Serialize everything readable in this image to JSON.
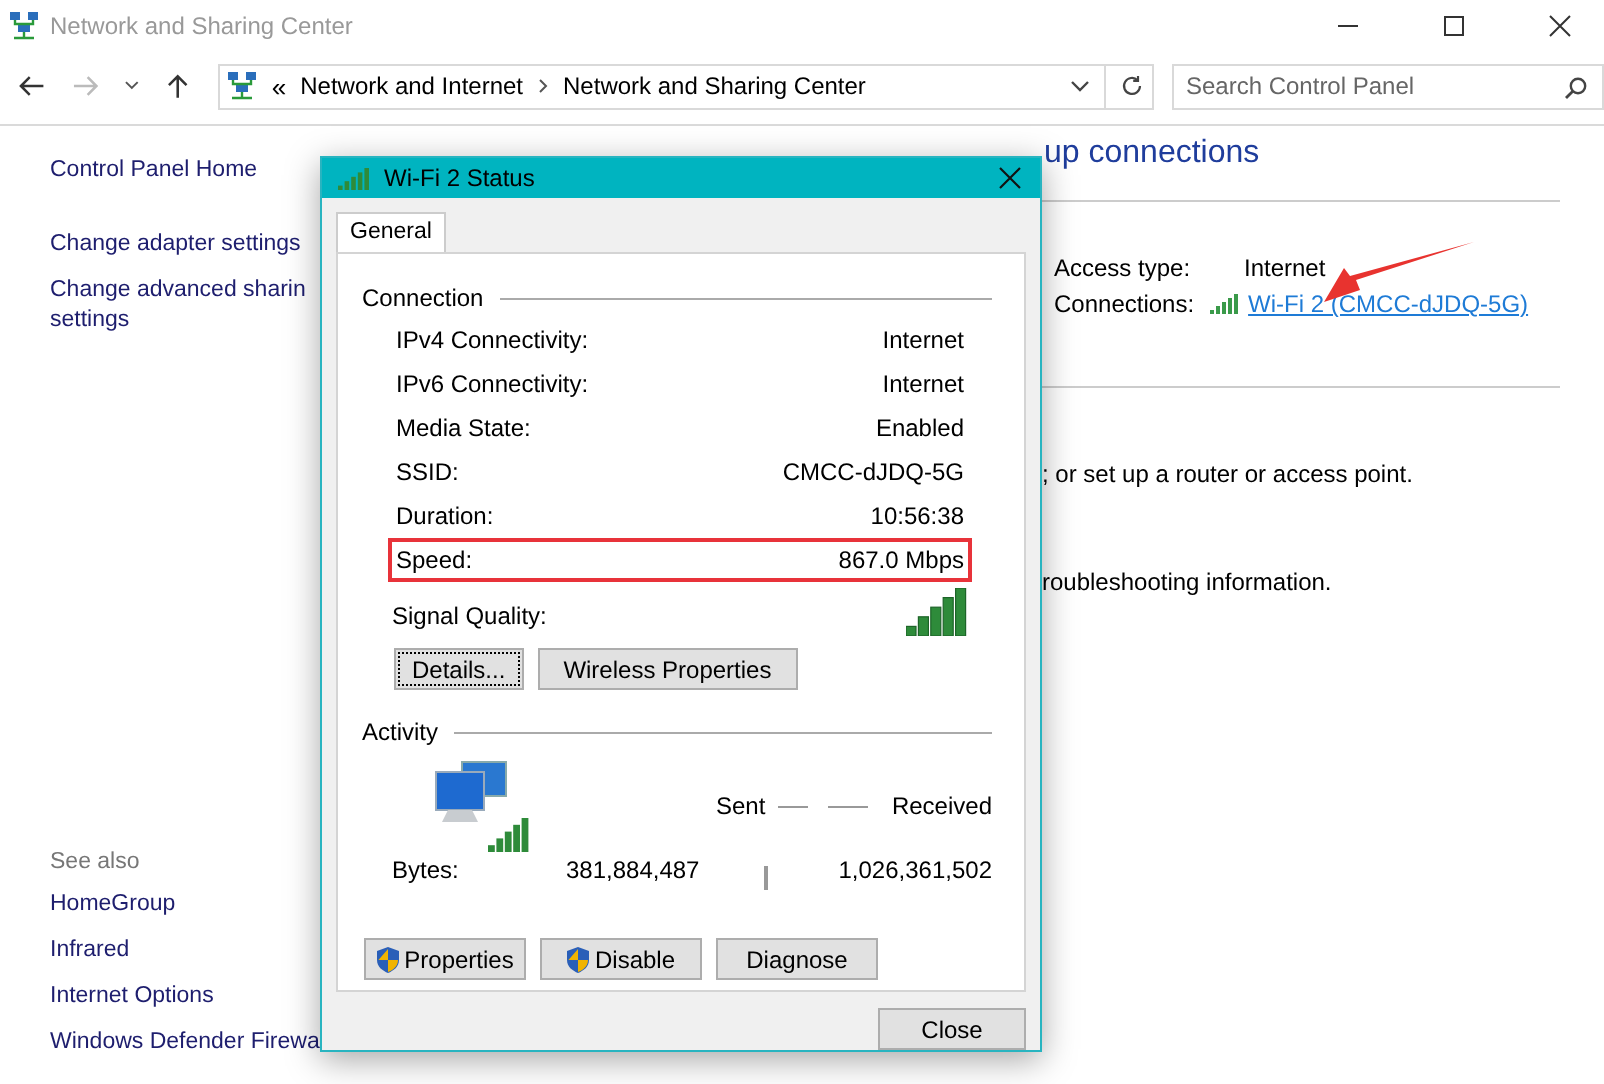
{
  "window": {
    "title": "Network and Sharing Center"
  },
  "address_bar": {
    "overflow": "«",
    "breadcrumb": [
      "Network and Internet",
      "Network and Sharing Center"
    ]
  },
  "search": {
    "placeholder": "Search Control Panel"
  },
  "sidebar": {
    "items": [
      "Control Panel Home",
      "Change adapter settings",
      "Change advanced sharin\nsettings"
    ],
    "see_also": {
      "title": "See also",
      "items": [
        "HomeGroup",
        "Infrared",
        "Internet Options",
        "Windows Defender Firewa"
      ]
    }
  },
  "main": {
    "heading": "up connections",
    "access_type_label": "Access type:",
    "access_type": "Internet",
    "connections_label": "Connections:",
    "connection_link": "Wi-Fi 2 (CMCC-dJDQ-5G)",
    "texts": [
      "; or set up a router or access point.",
      "roubleshooting information."
    ]
  },
  "dialog": {
    "title": "Wi-Fi 2 Status",
    "tabs": [
      {
        "label": "General",
        "selected": true
      }
    ],
    "connection": {
      "title": "Connection",
      "rows": [
        {
          "label": "IPv4 Connectivity:",
          "value": "Internet",
          "highlighted": false
        },
        {
          "label": "IPv6 Connectivity:",
          "value": "Internet",
          "highlighted": false
        },
        {
          "label": "Media State:",
          "value": "Enabled",
          "highlighted": false
        },
        {
          "label": "SSID:",
          "value": "CMCC-dJDQ-5G",
          "highlighted": false
        },
        {
          "label": "Duration:",
          "value": "10:56:38",
          "highlighted": false
        },
        {
          "label": "Speed:",
          "value": "867.0 Mbps",
          "highlighted": true
        }
      ],
      "signal_label": "Signal Quality:",
      "buttons": [
        {
          "label": "Details...",
          "focused": true
        },
        {
          "label": "Wireless Properties",
          "focused": false
        }
      ]
    },
    "activity": {
      "title": "Activity",
      "sent_label": "Sent",
      "received_label": "Received",
      "bytes_label": "Bytes:",
      "sent": "381,884,487",
      "received": "1,026,361,502"
    },
    "buttons": [
      {
        "label": "Properties",
        "shield": true
      },
      {
        "label": "Disable",
        "shield": true
      },
      {
        "label": "Diagnose",
        "shield": false
      }
    ],
    "close": "Close"
  }
}
